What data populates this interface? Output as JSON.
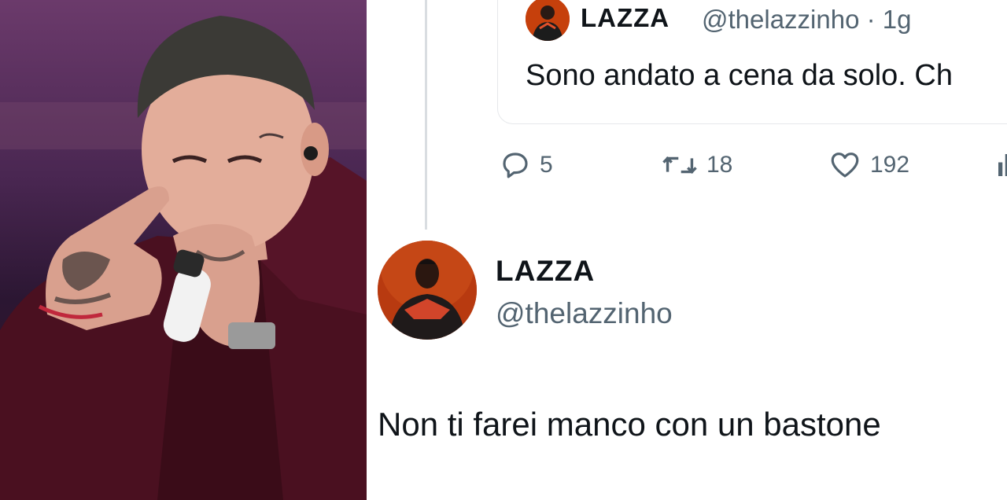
{
  "photo": {
    "description_icon": "performer-photo"
  },
  "quoted_tweet": {
    "author_name": "LAZZA",
    "author_handle": "@thelazzinho · 1g",
    "text": "Sono andato a cena da solo. Ch"
  },
  "actions": {
    "reply_count": "5",
    "retweet_count": "18",
    "like_count": "192"
  },
  "reply_tweet": {
    "author_name": "LAZZA",
    "author_handle": "@thelazzinho",
    "text": "Non ti farei manco con un bastone"
  },
  "colors": {
    "text_primary": "#0f1419",
    "text_secondary": "#536471",
    "border": "#e6e8eb",
    "avatar_accent": "#c6400c"
  }
}
